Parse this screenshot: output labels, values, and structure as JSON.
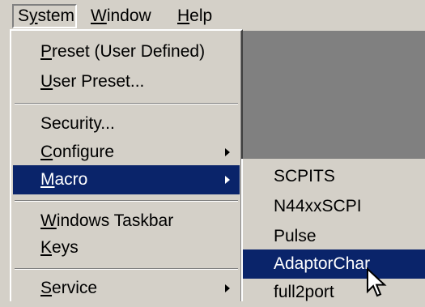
{
  "menubar": {
    "system": {
      "pre": "S",
      "u": "y",
      "post": "stem"
    },
    "window": {
      "pre": "",
      "u": "W",
      "post": "indow"
    },
    "help": {
      "pre": "",
      "u": "H",
      "post": "elp"
    }
  },
  "menu": {
    "preset": {
      "pre": "",
      "u": "P",
      "post": "reset (User Defined)"
    },
    "user_preset": {
      "pre": "",
      "u": "U",
      "post": "ser Preset..."
    },
    "security": {
      "pre": "",
      "u": "",
      "post": "Security..."
    },
    "configure": {
      "pre": "",
      "u": "C",
      "post": "onfigure"
    },
    "macro": {
      "pre": "",
      "u": "M",
      "post": "acro"
    },
    "windows_taskbar": {
      "pre": "",
      "u": "W",
      "post": "indows Taskbar"
    },
    "keys": {
      "pre": "",
      "u": "K",
      "post": "eys"
    },
    "service": {
      "pre": "",
      "u": "S",
      "post": "ervice"
    }
  },
  "submenu": {
    "items": [
      "SCPITS",
      "N44xxSCPI",
      "Pulse",
      "AdaptorChar",
      "full2port"
    ],
    "selected_index": 3
  },
  "colors": {
    "menu_bg": "#d4d0c8",
    "highlight": "#0a246a",
    "highlight_text": "#ffffff",
    "workspace": "#808080"
  },
  "icons": {
    "cursor": "mouse-pointer-icon",
    "submenu_arrow": "submenu-arrow-icon"
  }
}
